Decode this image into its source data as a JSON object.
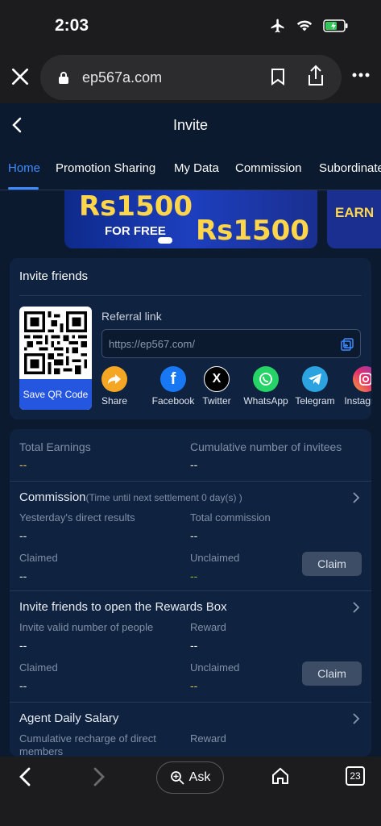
{
  "status": {
    "time": "2:03"
  },
  "browser": {
    "url": "ep567a.com"
  },
  "app": {
    "title": "Invite",
    "tabs": [
      "Home",
      "Promotion Sharing",
      "My Data",
      "Commission",
      "Subordinate"
    ],
    "banner": {
      "amount_top": "Rs1500",
      "free_text": "FOR FREE",
      "amount_bottom": "Rs1500",
      "side_text": "EARN"
    }
  },
  "invite": {
    "title": "Invite friends",
    "save_qr": "Save QR Code",
    "referral_label": "Referral link",
    "referral_url": "https://ep567.com/",
    "social": [
      "Share",
      "Facebook",
      "Twitter",
      "WhatsApp",
      "Telegram",
      "Instagram"
    ]
  },
  "stats": {
    "total_earnings_label": "Total Earnings",
    "total_earnings_value": "--",
    "invitees_label": "Cumulative number of invitees",
    "invitees_value": "--",
    "commission": {
      "title": "Commission",
      "note": "(Time until next settlement 0 day(s) )",
      "yesterday_label": "Yesterday's direct results",
      "yesterday_value": "--",
      "total_label": "Total commission",
      "total_value": "--",
      "claimed_label": "Claimed",
      "claimed_value": "--",
      "unclaimed_label": "Unclaimed",
      "unclaimed_value": "--",
      "claim_btn": "Claim"
    },
    "rewards_box": {
      "title": "Invite friends to open the Rewards Box",
      "valid_label": "Invite valid number of people",
      "valid_value": "--",
      "reward_label": "Reward",
      "reward_value": "--",
      "claimed_label": "Claimed",
      "claimed_value": "--",
      "unclaimed_label": "Unclaimed",
      "unclaimed_value": "--",
      "claim_btn": "Claim"
    },
    "agent_salary": {
      "title": "Agent Daily Salary",
      "recharge_label": "Cumulative recharge of direct members",
      "reward_label": "Reward",
      "reward_value": "--"
    }
  },
  "bottom": {
    "ask": "Ask",
    "tab_count": "23"
  },
  "colors": {
    "accent": "#3d8bff",
    "bg": "#0b1a2f",
    "card": "#0f2240",
    "value_gold": "#e0c060",
    "value_green": "#7fbf3a"
  }
}
